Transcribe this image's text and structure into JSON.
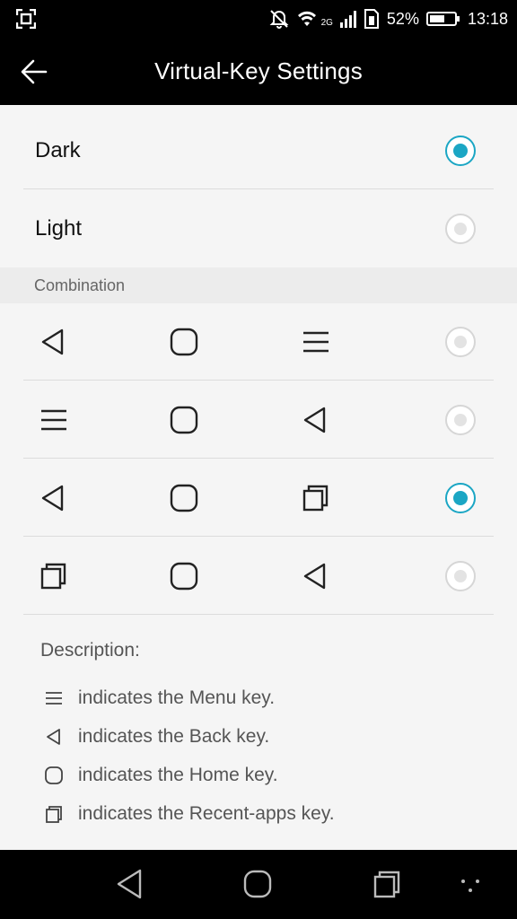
{
  "status_bar": {
    "battery_percent": "52%",
    "time": "13:18",
    "network_type": "2G",
    "icons": [
      "screenshot-icon",
      "muted-bell-icon",
      "wifi-icon",
      "signal-icon",
      "sim-icon",
      "battery-icon"
    ]
  },
  "app_bar": {
    "title": "Virtual-Key Settings",
    "back_icon": "arrow-left-icon"
  },
  "theme_options": [
    {
      "label": "Dark",
      "selected": true
    },
    {
      "label": "Light",
      "selected": false
    }
  ],
  "combination": {
    "header": "Combination",
    "options": [
      {
        "keys": [
          "back",
          "home",
          "menu"
        ],
        "selected": false
      },
      {
        "keys": [
          "menu",
          "home",
          "back"
        ],
        "selected": false
      },
      {
        "keys": [
          "back",
          "home",
          "recent"
        ],
        "selected": true
      },
      {
        "keys": [
          "recent",
          "home",
          "back"
        ],
        "selected": false
      }
    ]
  },
  "description": {
    "title": "Description:",
    "lines": [
      {
        "icon": "menu",
        "text": "indicates the Menu key."
      },
      {
        "icon": "back",
        "text": "indicates the Back key."
      },
      {
        "icon": "home",
        "text": "indicates the Home key."
      },
      {
        "icon": "recent",
        "text": "indicates the Recent-apps key."
      }
    ]
  },
  "colors": {
    "accent": "#1ba6c4",
    "bar_background": "#000000",
    "page_background": "#f5f5f5"
  }
}
